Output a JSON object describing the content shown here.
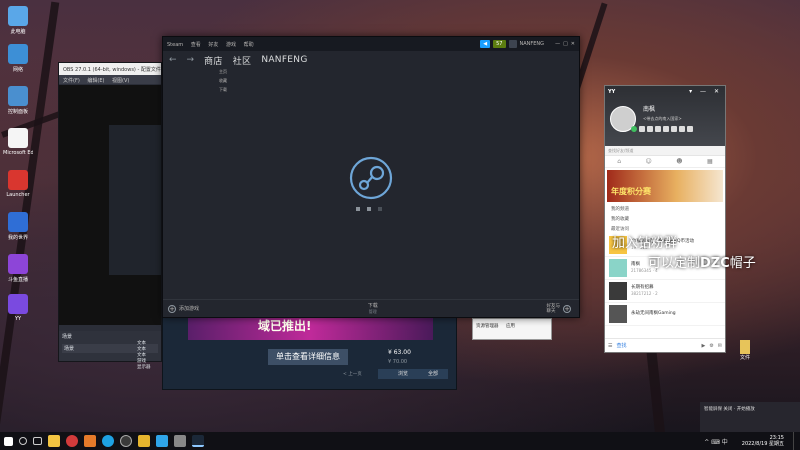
{
  "desktop": {
    "icons": [
      {
        "label": "此电脑",
        "color": "#5aa7e8"
      },
      {
        "label": "网络",
        "color": "#3d8fd6"
      },
      {
        "label": "控制面板",
        "color": "#4a8fcf"
      },
      {
        "label": "Microsoft Edge",
        "color": "#f5f5f5"
      },
      {
        "label": "Launcher",
        "color": "#d9362f"
      },
      {
        "label": "我的世界",
        "color": "#2f6ed6"
      },
      {
        "label": "斗鱼直播",
        "color": "#8d45d8"
      },
      {
        "label": "YY",
        "color": "#7a4ae0"
      }
    ],
    "right_file_label": "文件"
  },
  "obs": {
    "title": "OBS 27.0.1 (64-bit, windows) - 配置文件",
    "menu": [
      "文件(F)",
      "编辑(E)",
      "视图(V)"
    ],
    "dock_label": "场景",
    "scene": "场景",
    "sources": [
      "文本",
      "文本",
      "文本",
      "游戏",
      "显示器"
    ]
  },
  "steam": {
    "menu": [
      "Steam",
      "查看",
      "好友",
      "游戏",
      "帮助"
    ],
    "badge1": "◀",
    "badge2": "57",
    "username": "NANFENG",
    "nav": {
      "back": "←",
      "forward": "→",
      "store": "商店",
      "library": "社区",
      "profile": "NANFENG"
    },
    "dropdown": [
      "主页",
      "收藏",
      "下载"
    ],
    "bottom_left": "添加游戏",
    "bottom_center": "下载",
    "bottom_center_sub": "管理",
    "bottom_right": "好友与\n聊天"
  },
  "store": {
    "banner_text": "域已推出!",
    "details_button": "单击查看详细信息",
    "price_current": "¥ 63.00",
    "price_old": "¥ 70.00",
    "pager": "浏览",
    "prev": "< 上一页",
    "next": "全部"
  },
  "yy": {
    "brand": "YY",
    "nickname": "南枫",
    "signature": "<带去点的南入国家>",
    "search_placeholder": "查找好友/频道",
    "ad_text": "年度积分赛",
    "menu": [
      "我的频道",
      "我的收藏",
      "最近访问"
    ],
    "rows": [
      {
        "title": "YY福利大厅 - 免费领取Q币活动",
        "sub": "19 · 123"
      },
      {
        "title": "南枫",
        "sub": "21786345 · 4"
      },
      {
        "title": "长期有招募",
        "sub": "38217212 · 2"
      },
      {
        "title": "永劫无间南枫Gaming",
        "sub": ""
      }
    ],
    "bottom_label": "查找"
  },
  "overlay": {
    "line1": "加入钻粉群",
    "line2_a": "可以定制",
    "line2_b": "DZC",
    "line2_c": "帽子"
  },
  "popup": {
    "text1": "资源管理器",
    "text2": "应用"
  },
  "notification": {
    "text": "智能屏保 关闭 · 开始播放"
  },
  "taskbar": {
    "time": "23:15",
    "date": "2022/8/19 星期五",
    "tray": "^ ⌨ 中"
  }
}
